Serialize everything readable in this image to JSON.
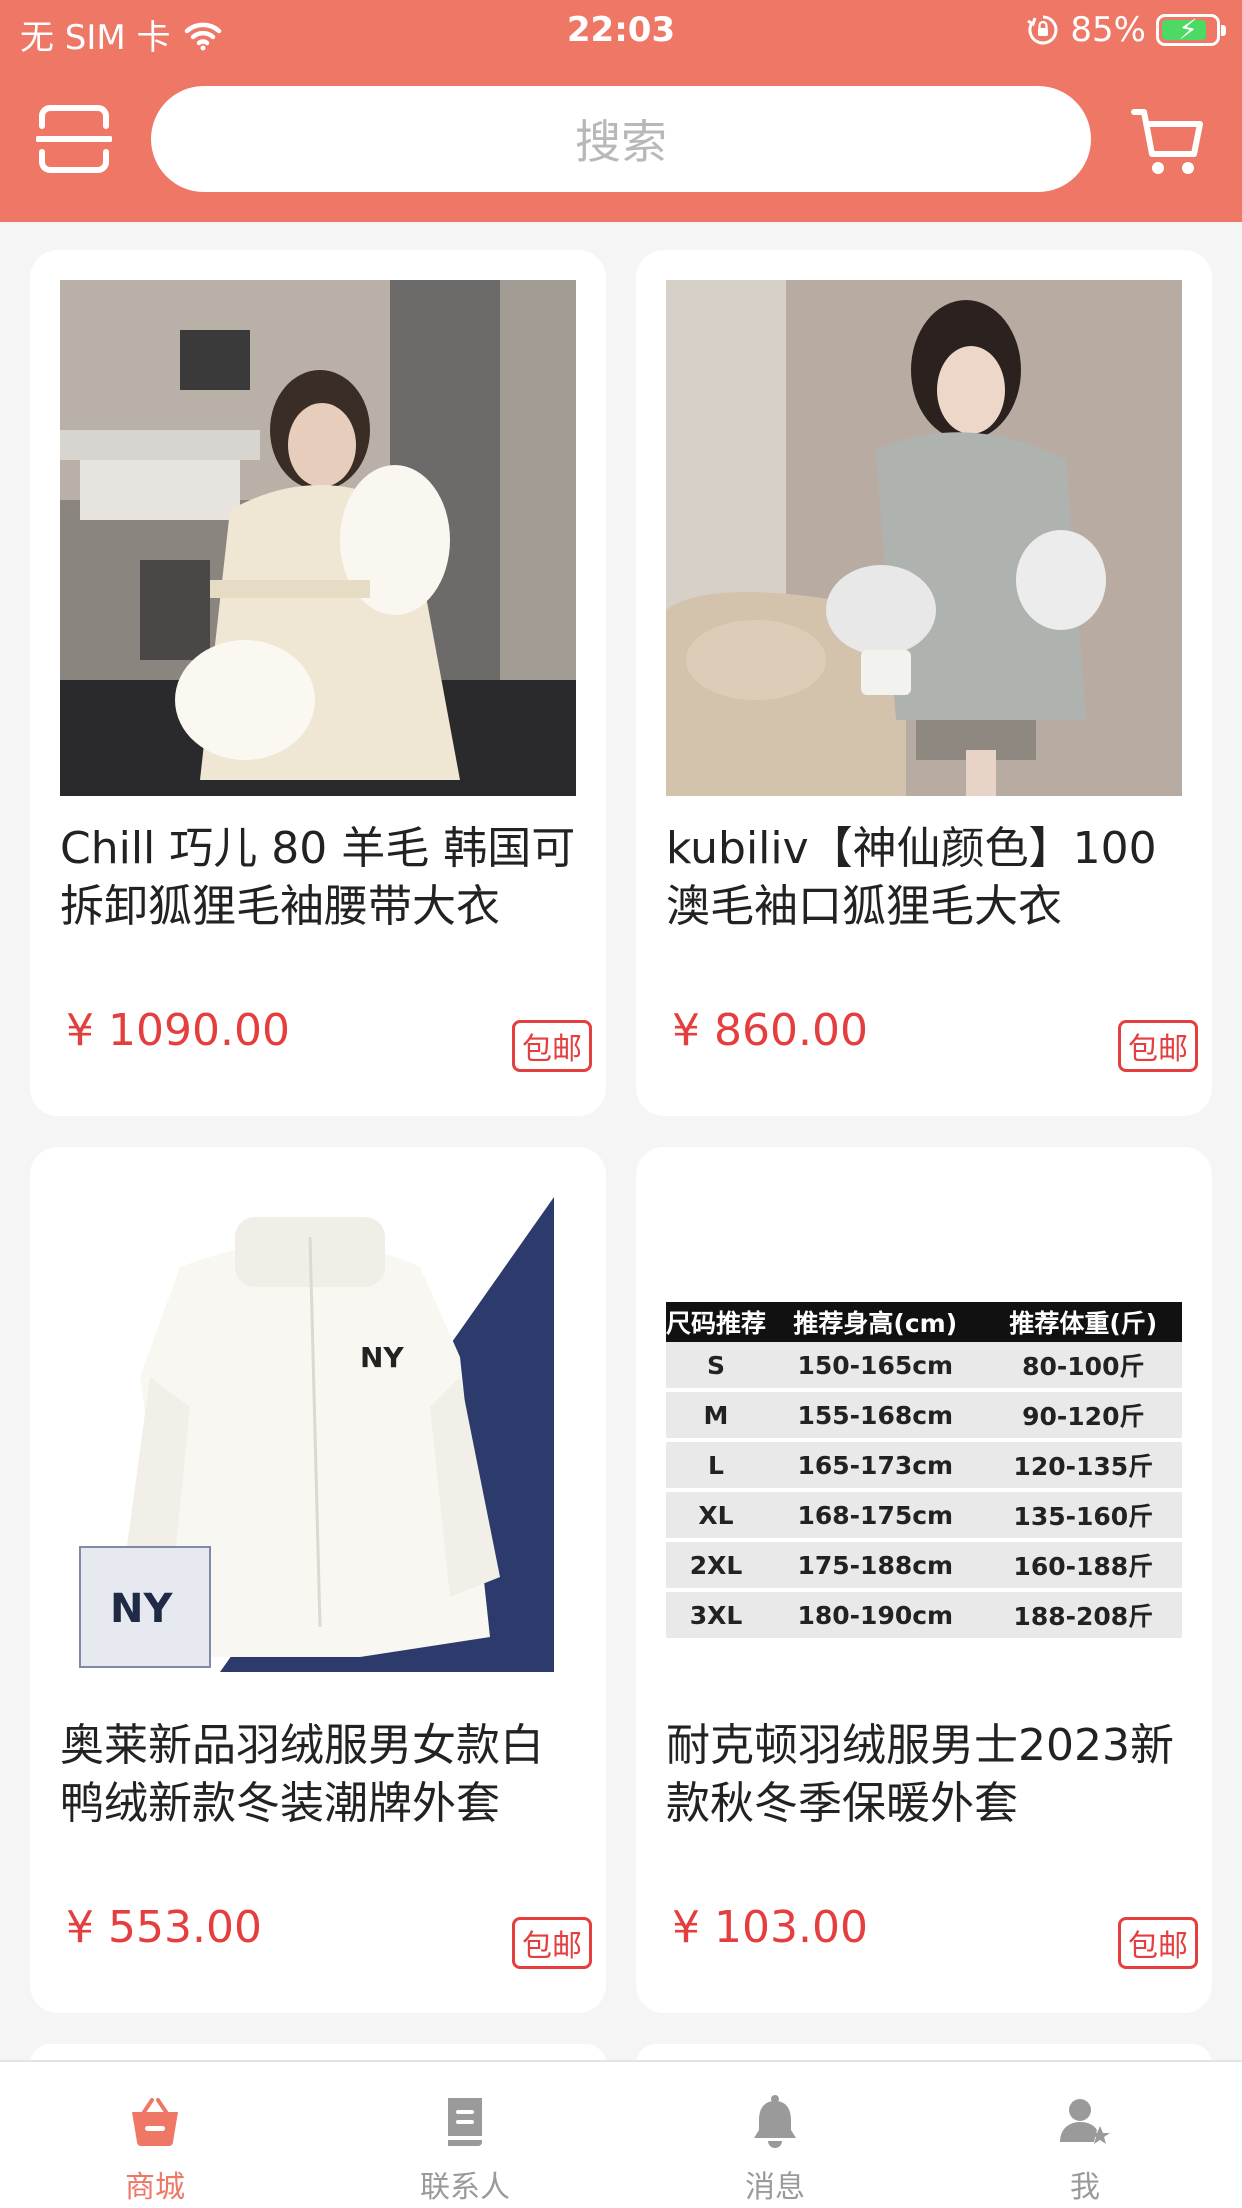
{
  "status_bar": {
    "carrier": "无 SIM 卡",
    "time": "22:03",
    "battery_percent": "85%",
    "battery_level": 0.85,
    "icons": [
      "wifi-icon",
      "orientation-lock-icon",
      "battery-charging-icon"
    ]
  },
  "header": {
    "search_placeholder": "搜索",
    "scan_icon": "scan-icon",
    "cart_icon": "cart-icon"
  },
  "colors": {
    "brand": "#ee7766",
    "price": "#e53e3e",
    "tab_active": "#ee7766",
    "tab_inactive": "#9a9a9a",
    "background": "#f5f5f5"
  },
  "products": [
    {
      "title": "Chill 巧儿 80 羊毛 韩国可拆卸狐狸毛袖腰带大衣",
      "price": "¥ 1090.00",
      "badge": "包邮"
    },
    {
      "title": "kubiliv【神仙颜色】100 澳毛袖口狐狸毛大衣",
      "price": "¥ 860.00",
      "badge": "包邮"
    },
    {
      "title": "奥莱新品羽绒服男女款白鸭绒新款冬装潮牌外套",
      "price": "¥ 553.00",
      "badge": "包邮"
    },
    {
      "title": "耐克顿羽绒服男士2023新款秋冬季保暖外套",
      "price": "¥ 103.00",
      "badge": "包邮"
    }
  ],
  "size_chart": {
    "headers": [
      "尺码推荐",
      "推荐身高(cm)",
      "推荐体重(斤)"
    ],
    "rows": [
      [
        "S",
        "150-165cm",
        "80-100斤"
      ],
      [
        "M",
        "155-168cm",
        "90-120斤"
      ],
      [
        "L",
        "165-173cm",
        "120-135斤"
      ],
      [
        "XL",
        "168-175cm",
        "135-160斤"
      ],
      [
        "2XL",
        "175-188cm",
        "160-188斤"
      ],
      [
        "3XL",
        "180-190cm",
        "188-208斤"
      ]
    ]
  },
  "tabbar": {
    "items": [
      {
        "label": "商城",
        "icon": "shop-basket-icon",
        "active": true
      },
      {
        "label": "联系人",
        "icon": "contacts-book-icon",
        "active": false
      },
      {
        "label": "消息",
        "icon": "bell-icon",
        "active": false
      },
      {
        "label": "我",
        "icon": "user-profile-icon",
        "active": false
      }
    ]
  }
}
